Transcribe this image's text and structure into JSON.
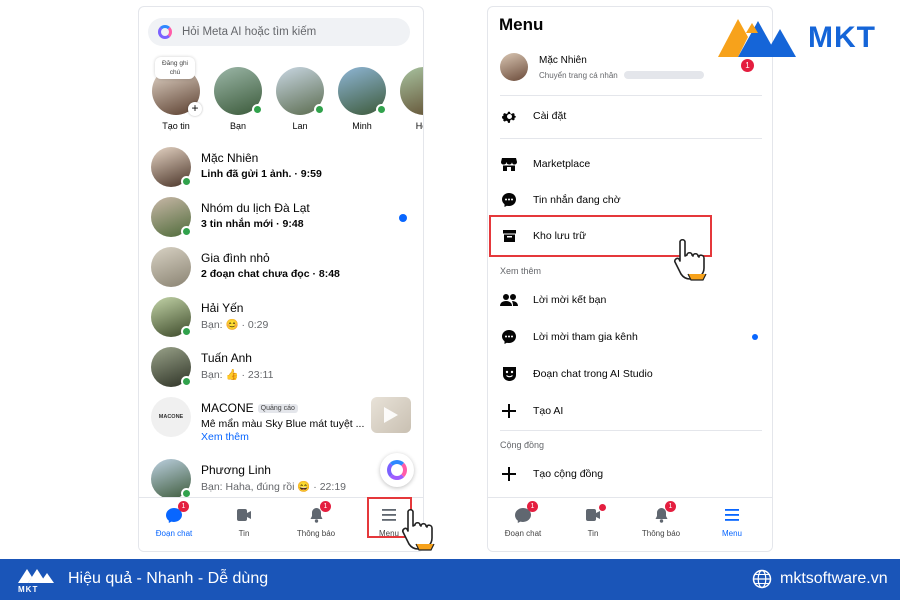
{
  "left": {
    "search_placeholder": "Hỏi Meta AI hoặc tìm kiếm",
    "note_text": "Đăng ghi chú",
    "stories": [
      {
        "label": "Tạo tin"
      },
      {
        "label": "Bạn"
      },
      {
        "label": "Lan"
      },
      {
        "label": "Minh"
      },
      {
        "label": "Hoà"
      }
    ],
    "chats": [
      {
        "name": "Mặc Nhiên",
        "message": "Linh đã gửi 1 ảnh. · 9:59",
        "unread": true
      },
      {
        "name": "Nhóm du lịch Đà Lạt",
        "message": "3 tin nhắn mới · 9:48",
        "unread": true
      },
      {
        "name": "Gia đình nhỏ",
        "message": "2 đoạn chat chưa đọc · 8:48",
        "unread": true
      },
      {
        "name": "Hải Yến",
        "message": "Bạn: 😊 · 0:29",
        "unread": false
      },
      {
        "name": "Tuấn Anh",
        "message": "Bạn: 👍 · 23:11",
        "unread": false
      },
      {
        "name": "MACONE",
        "badge": "Quảng cáo",
        "message": "Mê mẩn màu Sky Blue mát tuyệt ...",
        "link": "Xem thêm",
        "avatar_text": "MACONE"
      },
      {
        "name": "Phương Linh",
        "message": "Bạn: Haha, đúng rồi 😄 · 22:19",
        "unread": false
      }
    ],
    "nav": [
      {
        "label": "Đoạn chat",
        "badge": "1",
        "icon": "chat-bubble-icon"
      },
      {
        "label": "Tin",
        "icon": "video-icon"
      },
      {
        "label": "Thông báo",
        "badge": "1",
        "icon": "bell-icon"
      },
      {
        "label": "Menu",
        "icon": "hamburger-icon"
      }
    ]
  },
  "right": {
    "title": "Menu",
    "profile": {
      "name": "Mặc Nhiên",
      "subtitle": "Chuyển trang cá nhân",
      "badge": "1"
    },
    "items_top": [
      {
        "label": "Cài đặt",
        "icon": "gear-icon"
      },
      {
        "label": "Marketplace",
        "icon": "shop-icon"
      },
      {
        "label": "Tin nhắn đang chờ",
        "icon": "chat-dots-icon"
      },
      {
        "label": "Kho lưu trữ",
        "icon": "archive-icon"
      }
    ],
    "section_more": "Xem thêm",
    "items_more": [
      {
        "label": "Lời mời kết bạn",
        "icon": "people-icon"
      },
      {
        "label": "Lời mời tham gia kênh",
        "icon": "chat-dots-icon"
      },
      {
        "label": "Đoạn chat trong AI Studio",
        "icon": "ai-face-icon"
      },
      {
        "label": "Tạo AI",
        "icon": "plus-icon"
      }
    ],
    "section_community": "Cộng đồng",
    "items_community": [
      {
        "label": "Tạo cộng đồng",
        "icon": "plus-icon"
      }
    ],
    "nav": [
      {
        "label": "Đoạn chat",
        "badge": "1"
      },
      {
        "label": "Tin"
      },
      {
        "label": "Thông báo",
        "badge": "1"
      },
      {
        "label": "Menu"
      }
    ]
  },
  "logo": {
    "text": "MKT"
  },
  "footer": {
    "tagline": "Hiệu quả - Nhanh - Dễ dùng",
    "website": "mktsoftware.vn",
    "logo_text": "MKT"
  },
  "colors": {
    "accent": "#0866ff",
    "online": "#31a24c",
    "highlight": "#e5383b",
    "footer": "#1a55b8",
    "brand": "#1565d8",
    "logo_orange": "#f7a21b"
  }
}
